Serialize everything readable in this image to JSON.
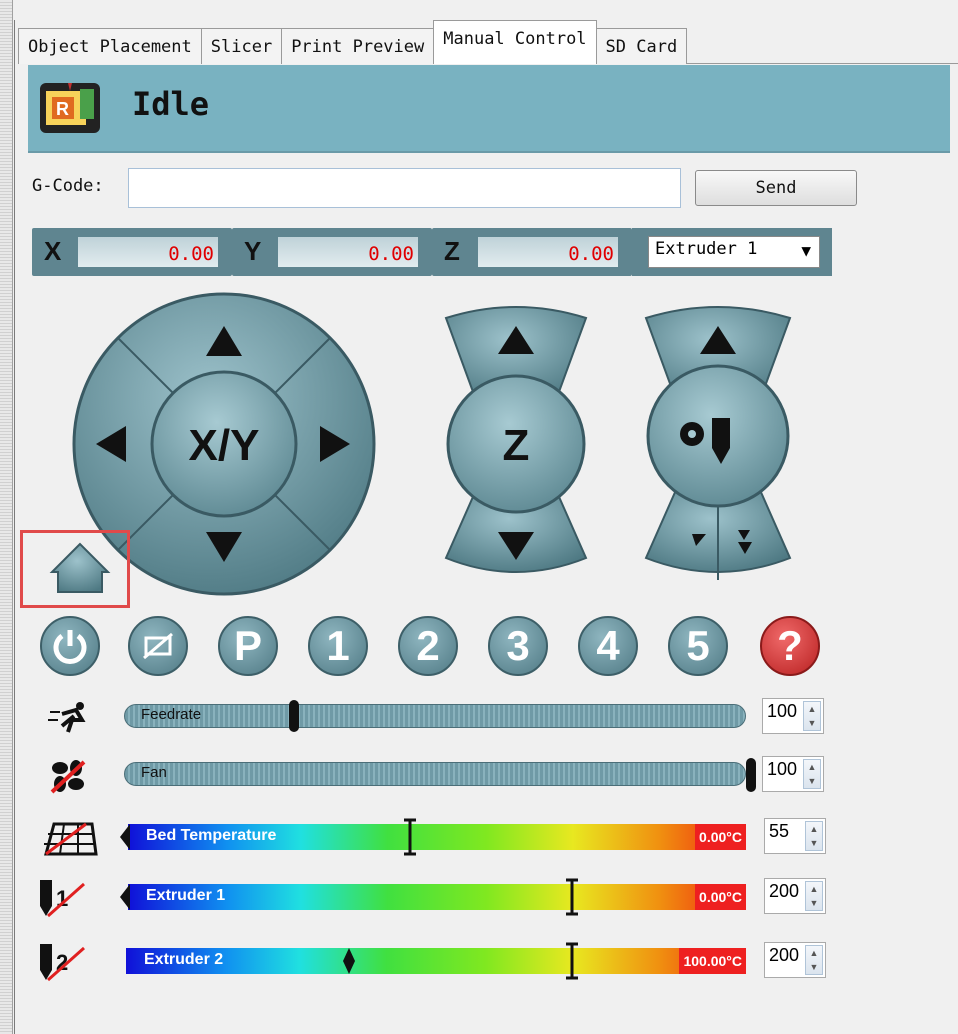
{
  "tabs": [
    {
      "label": "Object Placement"
    },
    {
      "label": "Slicer"
    },
    {
      "label": "Print Preview"
    },
    {
      "label": "Manual Control"
    },
    {
      "label": "SD Card"
    }
  ],
  "status": {
    "text": "Idle",
    "icon": "repetier-logo"
  },
  "gcode": {
    "label": "G-Code:",
    "value": "",
    "send_label": "Send"
  },
  "coords": {
    "x": {
      "label": "X",
      "value": "0.00"
    },
    "y": {
      "label": "Y",
      "value": "0.00"
    },
    "z": {
      "label": "Z",
      "value": "0.00"
    },
    "extruder_select": "Extruder 1"
  },
  "jog": {
    "xy_label": "X/Y",
    "z_label": "Z",
    "home_icon": "home-icon"
  },
  "function_buttons": [
    {
      "name": "power",
      "label": "⏻"
    },
    {
      "name": "motors-off",
      "label": ""
    },
    {
      "name": "park",
      "label": "P"
    },
    {
      "name": "macro-1",
      "label": "1"
    },
    {
      "name": "macro-2",
      "label": "2"
    },
    {
      "name": "macro-3",
      "label": "3"
    },
    {
      "name": "macro-4",
      "label": "4"
    },
    {
      "name": "macro-5",
      "label": "5"
    },
    {
      "name": "help",
      "label": "?"
    }
  ],
  "sliders": {
    "feedrate": {
      "label": "Feedrate",
      "value": "100",
      "position": 0.28
    },
    "fan": {
      "label": "Fan",
      "value": "100",
      "position": 1.0
    },
    "bed": {
      "label": "Bed Temperature",
      "current": "0.00°C",
      "target": "55",
      "target_position": 0.47
    },
    "extruder1": {
      "label": "Extruder 1",
      "current": "0.00°C",
      "target": "200",
      "target_position": 0.73
    },
    "extruder2": {
      "label": "Extruder 2",
      "current": "100.00°C",
      "target": "200",
      "target_position": 0.73,
      "current_position": 0.36
    }
  },
  "colors": {
    "accent": "#79b2c1",
    "button": "#5f8590",
    "alert": "#ee2020",
    "coord_text": "#e00000"
  }
}
